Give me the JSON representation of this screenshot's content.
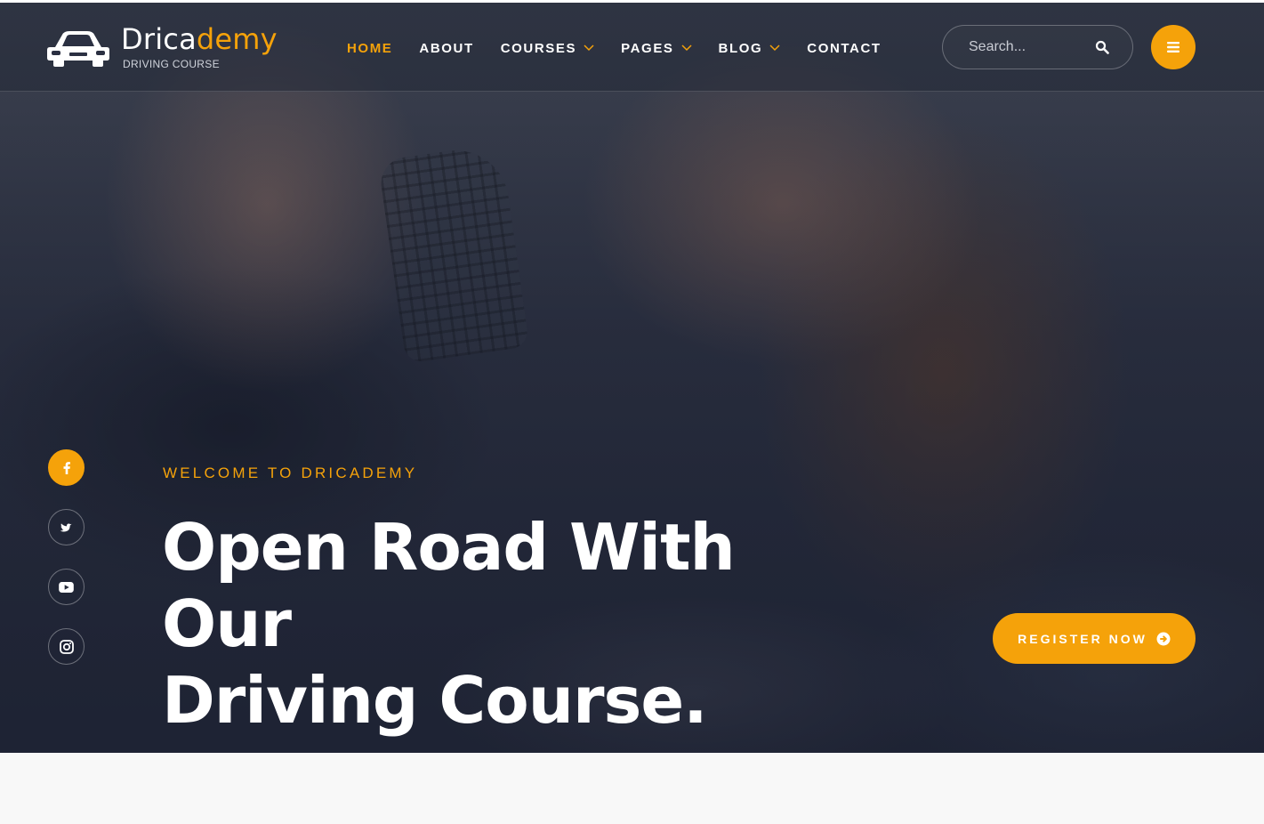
{
  "brand": {
    "name_main": "Drica",
    "name_accent": "demy",
    "tagline": "DRIVING COURSE",
    "accent_color": "#f5a20a"
  },
  "nav": {
    "items": [
      {
        "label": "HOME",
        "active": true,
        "dropdown": false
      },
      {
        "label": "ABOUT",
        "active": false,
        "dropdown": false
      },
      {
        "label": "COURSES",
        "active": false,
        "dropdown": true
      },
      {
        "label": "PAGES",
        "active": false,
        "dropdown": true
      },
      {
        "label": "BLOG",
        "active": false,
        "dropdown": true
      },
      {
        "label": "CONTACT",
        "active": false,
        "dropdown": false
      }
    ]
  },
  "search": {
    "placeholder": "Search...",
    "value": "",
    "icon": "search-icon"
  },
  "menu_button": {
    "icon": "hamburger-icon"
  },
  "social": [
    {
      "name": "facebook",
      "icon": "facebook-icon",
      "active": true
    },
    {
      "name": "twitter",
      "icon": "twitter-icon",
      "active": false
    },
    {
      "name": "youtube",
      "icon": "youtube-icon",
      "active": false
    },
    {
      "name": "instagram",
      "icon": "instagram-icon",
      "active": false
    }
  ],
  "hero": {
    "eyebrow": "WELCOME TO DRICADEMY",
    "headline_line1": "Open Road With Our",
    "headline_line2": "Driving Course.",
    "cta_label": "REGISTER NOW",
    "cta_icon": "arrow-circle-right-icon"
  }
}
